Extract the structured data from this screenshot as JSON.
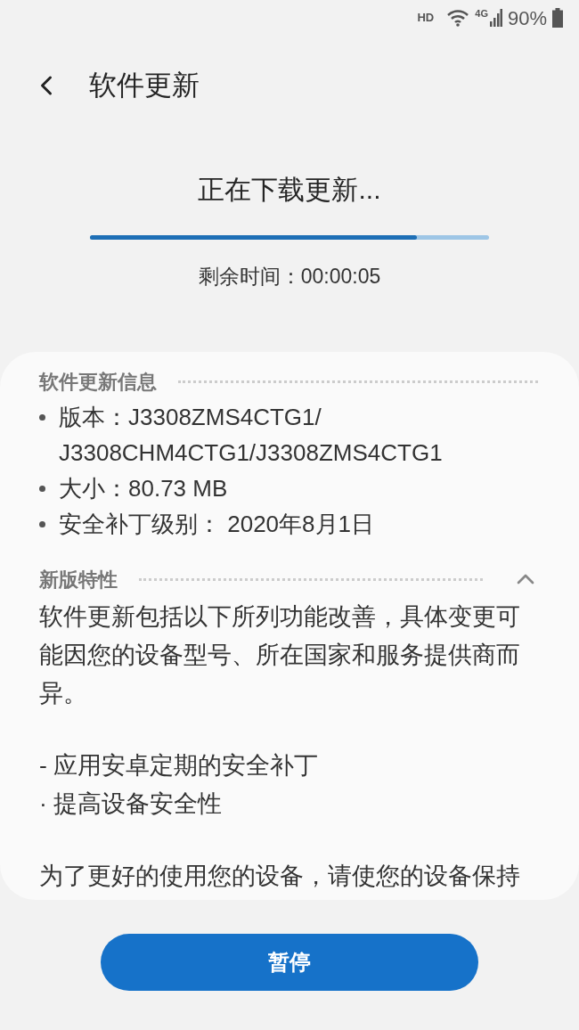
{
  "status_bar": {
    "hd": "HD",
    "network": "4G",
    "battery": "90%"
  },
  "header": {
    "title": "软件更新"
  },
  "progress": {
    "title": "正在下载更新...",
    "level": 0.82,
    "remaining": "剩余时间：00:00:05"
  },
  "info": {
    "heading": "软件更新信息",
    "items": [
      {
        "lines": [
          "版本：J3308ZMS4CTG1/",
          "J3308CHM4CTG1/J3308ZMS4CTG1"
        ]
      },
      {
        "lines": [
          "大小：80.73 MB"
        ]
      },
      {
        "lines": [
          "安全补丁级别： 2020年8月1日"
        ]
      }
    ]
  },
  "whats_new": {
    "heading": "新版特性",
    "expanded": true,
    "paragraphs": [
      [
        "软件更新包括以下所列功能改善，具体变更可能因您的设备型号、所在国家和服务提供商而异。"
      ],
      [
        "- 应用安卓定期的安全补丁",
        "· 提高设备安全性"
      ],
      [
        "为了更好的使用您的设备，请使您的设备保持"
      ]
    ]
  },
  "button": "暂停"
}
